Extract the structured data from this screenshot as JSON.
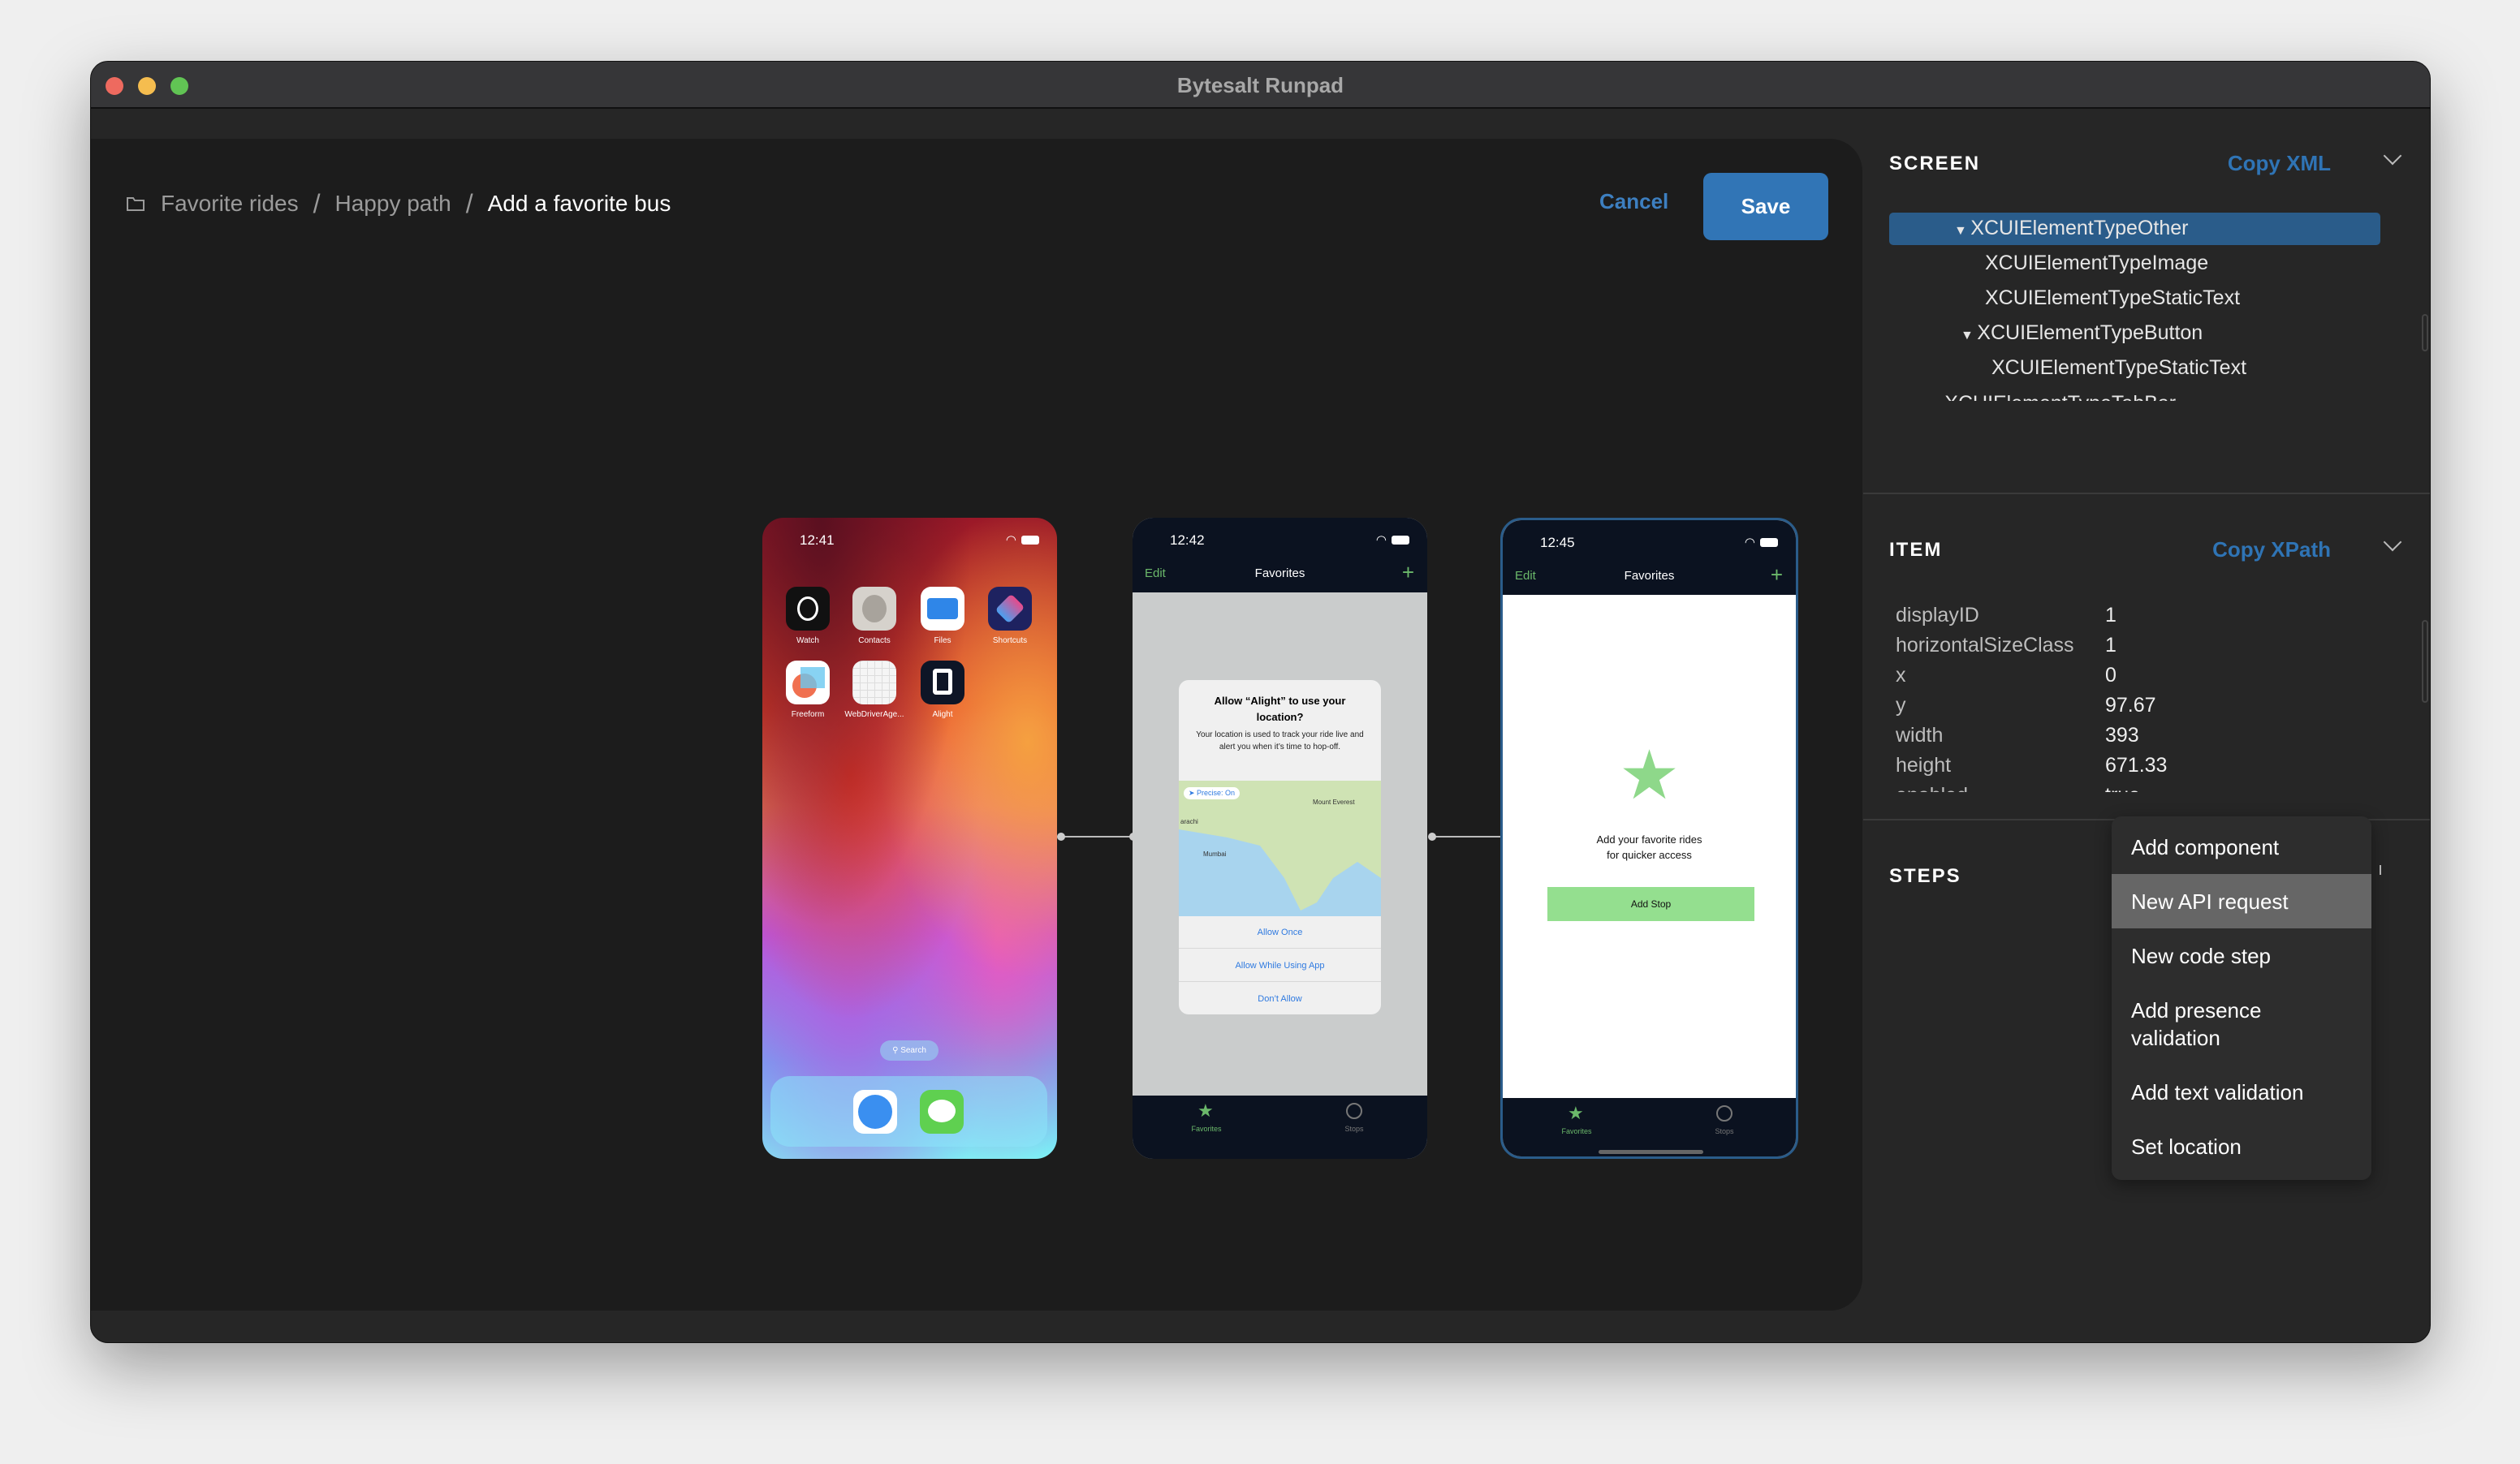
{
  "window": {
    "title": "Bytesalt Runpad"
  },
  "breadcrumb": {
    "items": [
      "Favorite rides",
      "Happy path",
      "Add a favorite bus"
    ],
    "icon": "folder-icon"
  },
  "toolbar": {
    "cancel_label": "Cancel",
    "save_label": "Save"
  },
  "colors": {
    "accent": "#3175b6",
    "selection": "#2a5c8a",
    "success_green": "#94df8f"
  },
  "phones": [
    {
      "time": "12:41",
      "apps": [
        "Watch",
        "Contacts",
        "Files",
        "Shortcuts",
        "Freeform",
        "WebDriverAge...",
        "Alight"
      ],
      "search": "Search",
      "dock": [
        "safari-icon",
        "messages-icon"
      ]
    },
    {
      "time": "12:42",
      "nav": {
        "left": "Edit",
        "title": "Favorites",
        "right": "+"
      },
      "alert": {
        "title": "Allow “Alight” to use your location?",
        "body": "Your location is used to track your ride live and alert you when it’s time to hop-off.",
        "precise": "Precise: On",
        "map_labels": [
          "Mount Everest",
          "arachi",
          "Mumbai"
        ],
        "buttons": [
          "Allow Once",
          "Allow While Using App",
          "Don’t Allow"
        ]
      },
      "tabs": [
        "Favorites",
        "Stops"
      ]
    },
    {
      "time": "12:45",
      "nav": {
        "left": "Edit",
        "title": "Favorites",
        "right": "+"
      },
      "empty_text": [
        "Add your favorite rides",
        "for quicker access"
      ],
      "button": "Add Stop",
      "tabs": [
        "Favorites",
        "Stops"
      ]
    }
  ],
  "screen": {
    "title": "SCREEN",
    "copy": "Copy XML",
    "tree": [
      {
        "label": "XCUIElementTypeOther",
        "expanded": true,
        "selected": true
      },
      {
        "label": "XCUIElementTypeImage"
      },
      {
        "label": "XCUIElementTypeStaticText"
      },
      {
        "label": "XCUIElementTypeButton",
        "expanded": true
      },
      {
        "label": "XCUIElementTypeStaticText"
      },
      {
        "label": "XCUIElementTypeTabBar",
        "expanded": true
      }
    ]
  },
  "item": {
    "title": "ITEM",
    "copy": "Copy XPath",
    "props": [
      {
        "k": "displayID",
        "v": "1"
      },
      {
        "k": "horizontalSizeClass",
        "v": "1"
      },
      {
        "k": "x",
        "v": "0"
      },
      {
        "k": "y",
        "v": "97.67"
      },
      {
        "k": "width",
        "v": "393"
      },
      {
        "k": "height",
        "v": "671.33"
      },
      {
        "k": "enabled",
        "v": "true"
      }
    ]
  },
  "steps": {
    "title": "STEPS",
    "menu": [
      "Add component",
      "New API request",
      "New code step",
      "Add presence validation",
      "Add text validation",
      "Set location"
    ],
    "highlighted": "New API request"
  }
}
